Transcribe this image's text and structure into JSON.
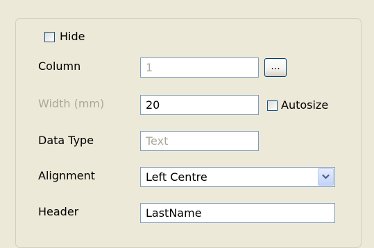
{
  "fields": {
    "hide": {
      "label": "Hide",
      "checked": false
    },
    "column": {
      "label": "Column",
      "value": "1",
      "button_label": "...",
      "enabled": false
    },
    "width": {
      "label": "Width (mm)",
      "value": "20",
      "enabled": false
    },
    "autosize": {
      "label": "Autosize",
      "checked": false
    },
    "data_type": {
      "label": "Data Type",
      "value": "Text",
      "enabled": false
    },
    "alignment": {
      "label": "Alignment",
      "selected": "Left Centre"
    },
    "header": {
      "label": "Header",
      "value": "LastName"
    }
  },
  "icons": {
    "dropdown": "chevron-down-icon"
  },
  "colors": {
    "window_bg": "#ECE9D8",
    "field_border": "#7F9DB9",
    "disabled_text": "#ACA899",
    "dropdown_accent": "#4D6185"
  }
}
